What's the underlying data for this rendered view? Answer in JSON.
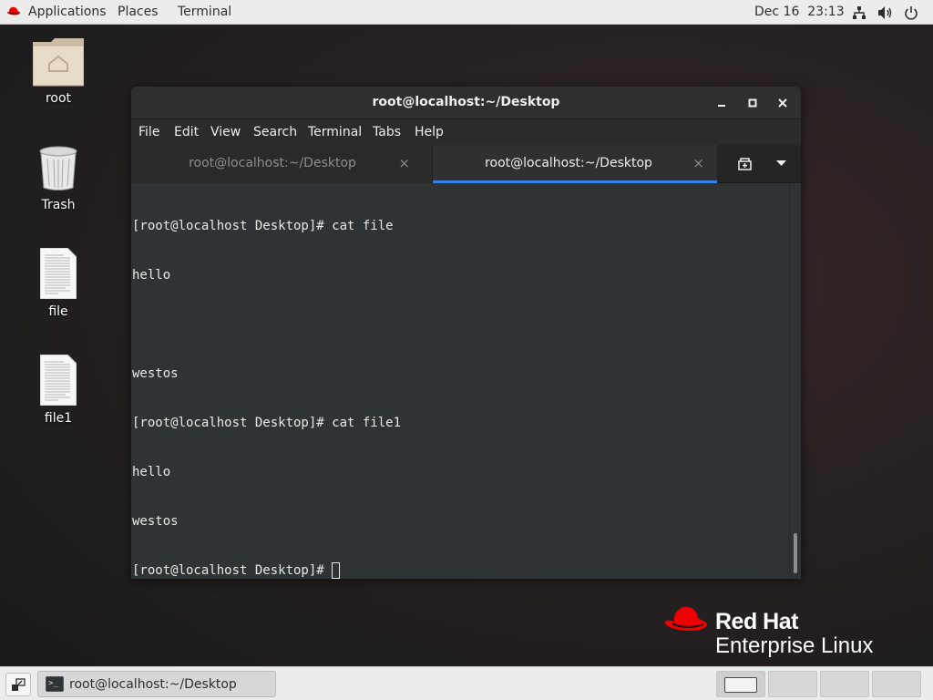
{
  "topbar": {
    "applications": "Applications",
    "places": "Places",
    "terminal": "Terminal",
    "datetime": "Dec 16  23:13",
    "icons": [
      "network-icon",
      "volume-icon",
      "power-icon"
    ]
  },
  "desktop": {
    "icons": [
      {
        "label": "root",
        "icon": "home-folder-icon"
      },
      {
        "label": "Trash",
        "icon": "trash-icon"
      },
      {
        "label": "file",
        "icon": "text-file-icon"
      },
      {
        "label": "file1",
        "icon": "text-file-icon"
      }
    ]
  },
  "window": {
    "title": "root@localhost:~/Desktop",
    "menu": [
      "File",
      "Edit",
      "View",
      "Search",
      "Terminal",
      "Tabs",
      "Help"
    ],
    "tabs": [
      {
        "label": "root@localhost:~/Desktop",
        "active": false
      },
      {
        "label": "root@localhost:~/Desktop",
        "active": true
      }
    ],
    "close_glyph": "×",
    "terminal_lines": [
      "[root@localhost Desktop]# cat file",
      "hello",
      "",
      "westos",
      "[root@localhost Desktop]# cat file1",
      "hello",
      "westos"
    ],
    "prompt": "[root@localhost Desktop]# "
  },
  "branding": {
    "line1": "Red Hat",
    "line2": "Enterprise Linux",
    "accent": "#ee0000"
  },
  "taskbar": {
    "window_item": "root@localhost:~/Desktop",
    "workspaces": 4,
    "active_workspace": 1
  }
}
